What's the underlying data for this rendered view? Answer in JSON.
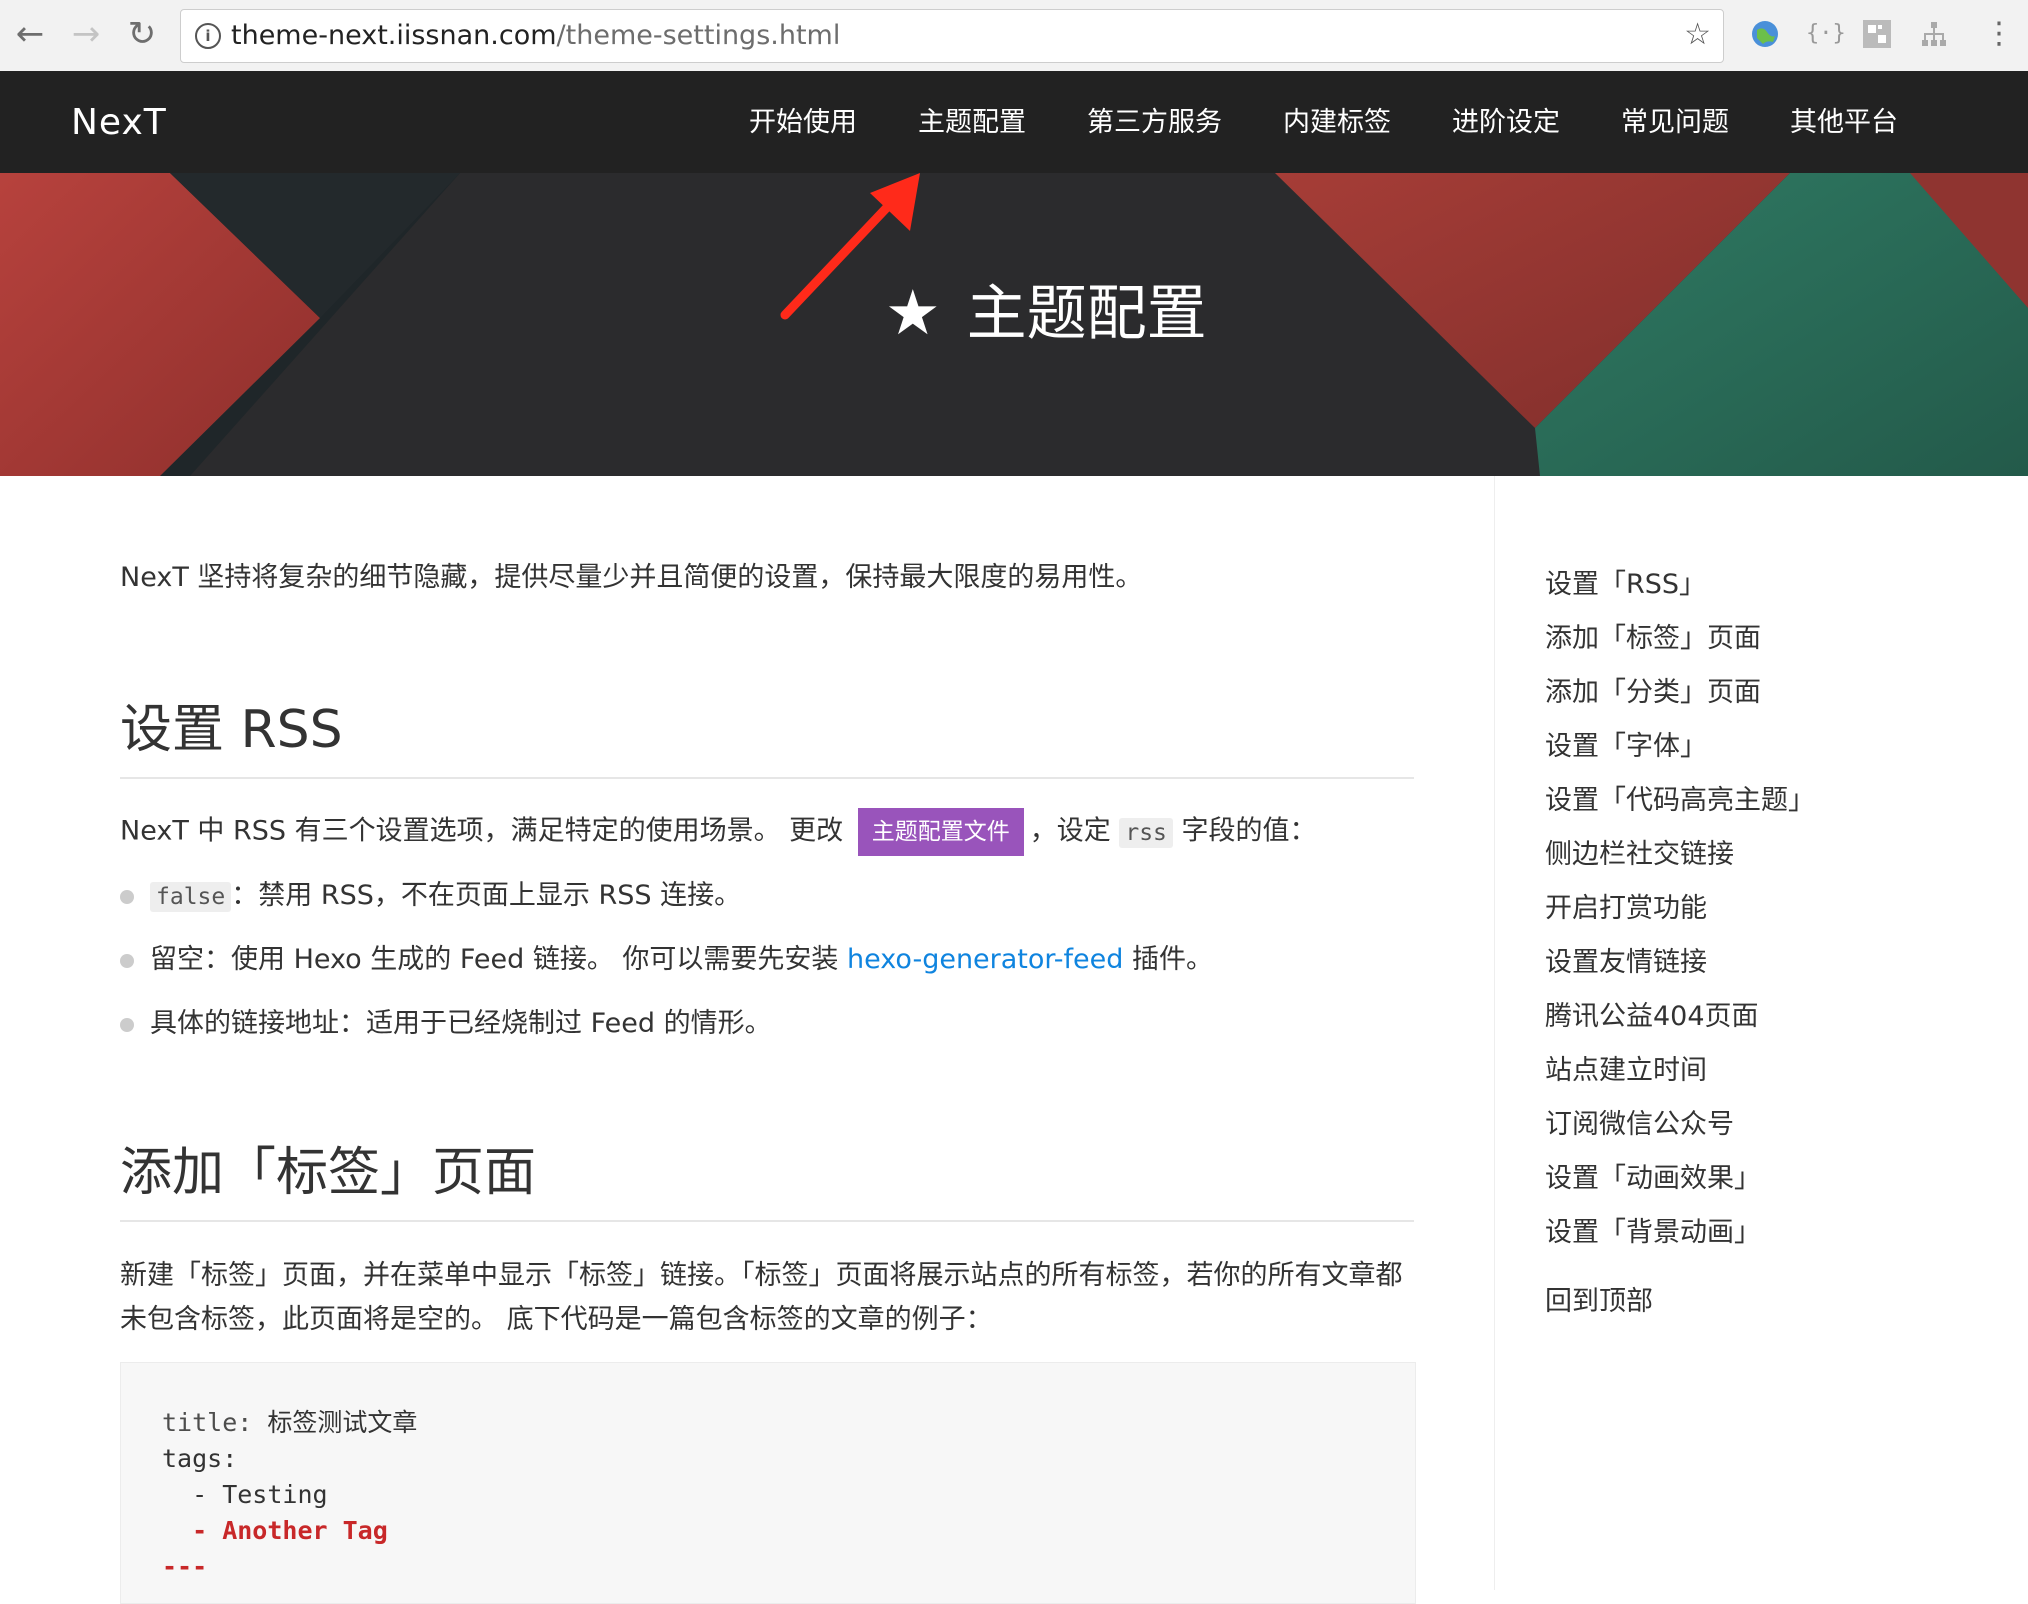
{
  "browser": {
    "url_host": "theme-next.iissnan.com",
    "url_path": "/theme-settings.html"
  },
  "site": {
    "brand": "NexT",
    "menu": [
      "开始使用",
      "主题配置",
      "第三方服务",
      "内建标签",
      "进阶设定",
      "常见问题",
      "其他平台"
    ]
  },
  "hero": {
    "title": "主题配置"
  },
  "content": {
    "intro": "NexT 坚持将复杂的细节隐藏，提供尽量少并且简便的设置，保持最大限度的易用性。",
    "rss_heading": "设置 RSS",
    "rss_para_before": "NexT 中 RSS 有三个设置选项，满足特定的使用场景。 更改",
    "rss_label": "主题配置文件",
    "rss_para_mid": "，设定",
    "rss_code": "rss",
    "rss_para_after": "字段的值：",
    "bullet1_code": "false",
    "bullet1_text": "：禁用 RSS，不在页面上显示 RSS 连接。",
    "bullet2_before": "留空：使用 Hexo 生成的 Feed 链接。 你可以需要先安装",
    "bullet2_link": "hexo-generator-feed",
    "bullet2_after": "插件。",
    "bullet3": "具体的链接地址：适用于已经烧制过 Feed 的情形。",
    "tag_heading": "添加「标签」页面",
    "tag_para": "新建「标签」页面，并在菜单中显示「标签」链接。「标签」页面将展示站点的所有标签，若你的所有文章都未包含标签，此页面将是空的。 底下代码是一篇包含标签的文章的例子：",
    "code_line1_key": "title:",
    "code_line1_val": " 标签测试文章",
    "code_line2": "tags:",
    "code_line3": "  - Testing",
    "code_line4": "  - Another Tag",
    "code_line5": "---"
  },
  "toc": {
    "items": [
      "设置「RSS」",
      "添加「标签」页面",
      "添加「分类」页面",
      "设置「字体」",
      "设置「代码高亮主题」",
      "侧边栏社交链接",
      "开启打赏功能",
      "设置友情链接",
      "腾讯公益404页面",
      "站点建立时间",
      "订阅微信公众号",
      "设置「动画效果」",
      "设置「背景动画」"
    ],
    "back_to_top": "回到顶部"
  }
}
